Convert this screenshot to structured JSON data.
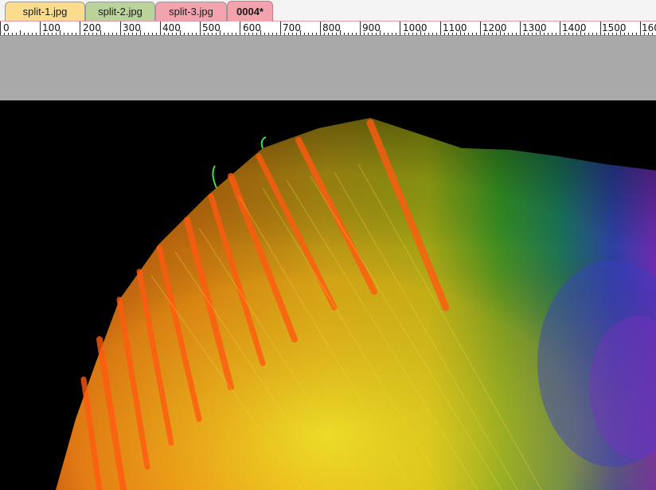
{
  "tabs": [
    {
      "label": "split-1.jpg",
      "color": "#fbdc8c",
      "active": false
    },
    {
      "label": "split-2.jpg",
      "color": "#bad39b",
      "active": false
    },
    {
      "label": "split-3.jpg",
      "color": "#f3a3ae",
      "active": false
    },
    {
      "label": "0004*",
      "color": "#f3a3ae",
      "active": true
    }
  ],
  "ruler": {
    "labels": [
      "0",
      "100",
      "200",
      "300",
      "400",
      "500",
      "600",
      "700",
      "800",
      "900",
      "1000",
      "1100",
      "1200",
      "1300",
      "1400",
      "1500",
      "160"
    ]
  },
  "canvas": {
    "background": "#000000"
  }
}
